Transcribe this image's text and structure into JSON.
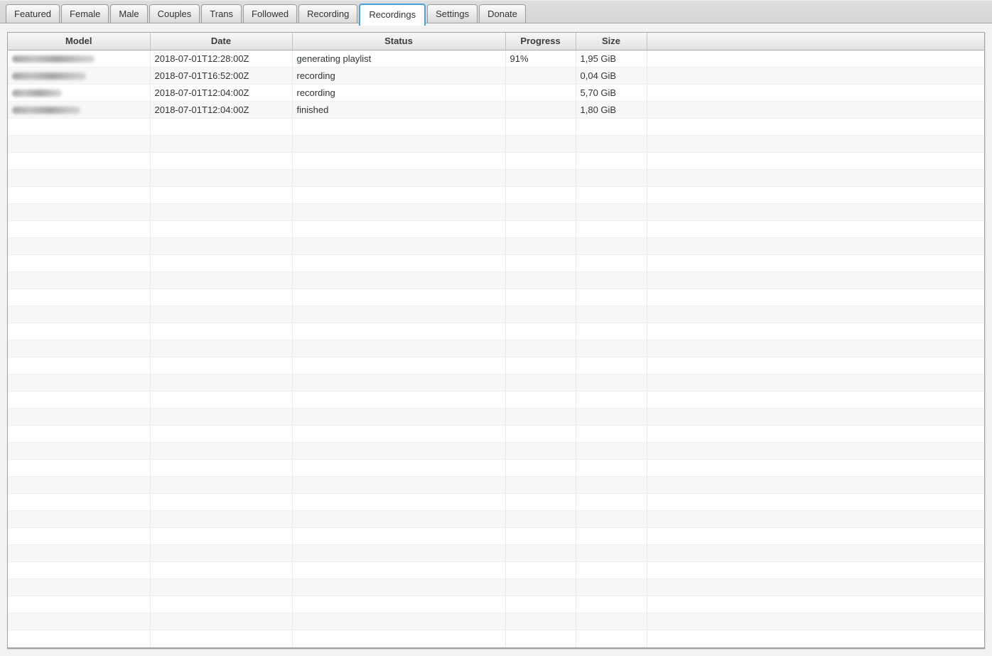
{
  "tabs": {
    "items": [
      "Featured",
      "Female",
      "Male",
      "Couples",
      "Trans",
      "Followed",
      "Recording",
      "Recordings",
      "Settings",
      "Donate"
    ],
    "active": "Recordings"
  },
  "recordings_table": {
    "columns": [
      "Model",
      "Date",
      "Status",
      "Progress",
      "Size",
      ""
    ],
    "rows": [
      {
        "model_redacted": true,
        "model_blur_width": 116,
        "date": "2018-07-01T12:28:00Z",
        "status": "generating playlist",
        "progress": "91%",
        "size": "1,95 GiB"
      },
      {
        "model_redacted": true,
        "model_blur_width": 104,
        "date": "2018-07-01T16:52:00Z",
        "status": "recording",
        "progress": "",
        "size": "0,04 GiB"
      },
      {
        "model_redacted": true,
        "model_blur_width": 70,
        "date": "2018-07-01T12:04:00Z",
        "status": "recording",
        "progress": "",
        "size": "5,70 GiB"
      },
      {
        "model_redacted": true,
        "model_blur_width": 96,
        "date": "2018-07-01T12:04:00Z",
        "status": "finished",
        "progress": "",
        "size": "1,80 GiB"
      }
    ],
    "empty_row_count": 31
  },
  "colors": {
    "active_tab_border": "#47a3dc",
    "row_stripe": "#f7f7f7",
    "header_text": "#3c3c3c"
  }
}
